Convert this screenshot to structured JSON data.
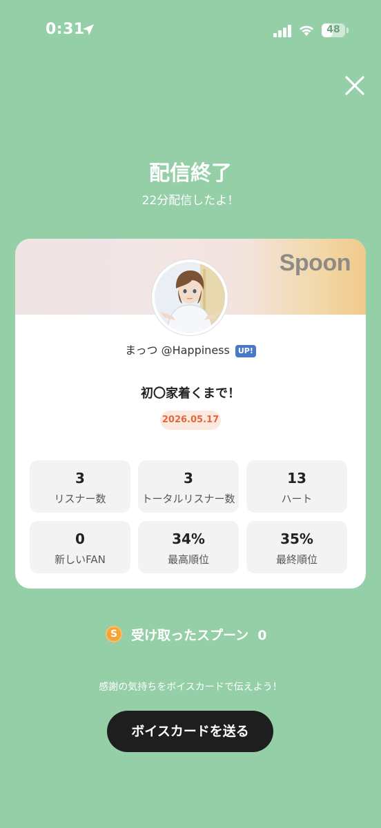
{
  "status_bar": {
    "time": "0:31",
    "battery": "48",
    "battery_level": 0.48,
    "icons": [
      "location-arrow-icon",
      "signal-icon",
      "wifi-icon",
      "battery-icon"
    ]
  },
  "header": {
    "close_icon": "close-icon",
    "title": "配信終了",
    "subtitle": "22分配信したよ！"
  },
  "card": {
    "brand": "Spoon",
    "username": "まっつ @Happiness",
    "badge": "UP!",
    "live_title": "初〇家着くまで！",
    "date": "2026.05.17",
    "stats": [
      {
        "value": "3",
        "label": "リスナー数"
      },
      {
        "value": "3",
        "label": "トータルリスナー数"
      },
      {
        "value": "13",
        "label": "ハート"
      },
      {
        "value": "0",
        "label": "新しいFAN"
      },
      {
        "value": "34%",
        "label": "最高順位"
      },
      {
        "value": "35%",
        "label": "最終順位"
      }
    ]
  },
  "spoons": {
    "icon": "spoon-coin-icon",
    "icon_letter": "S",
    "label": "受け取ったスプーン  0"
  },
  "thanks_text": "感謝の気持ちをボイスカードで伝えよう！",
  "voice_card_button": "ボイスカードを送る",
  "colors": {
    "background": "#95cfa8",
    "date_badge_text": "#e2683c",
    "button": "#1e1e1e"
  }
}
